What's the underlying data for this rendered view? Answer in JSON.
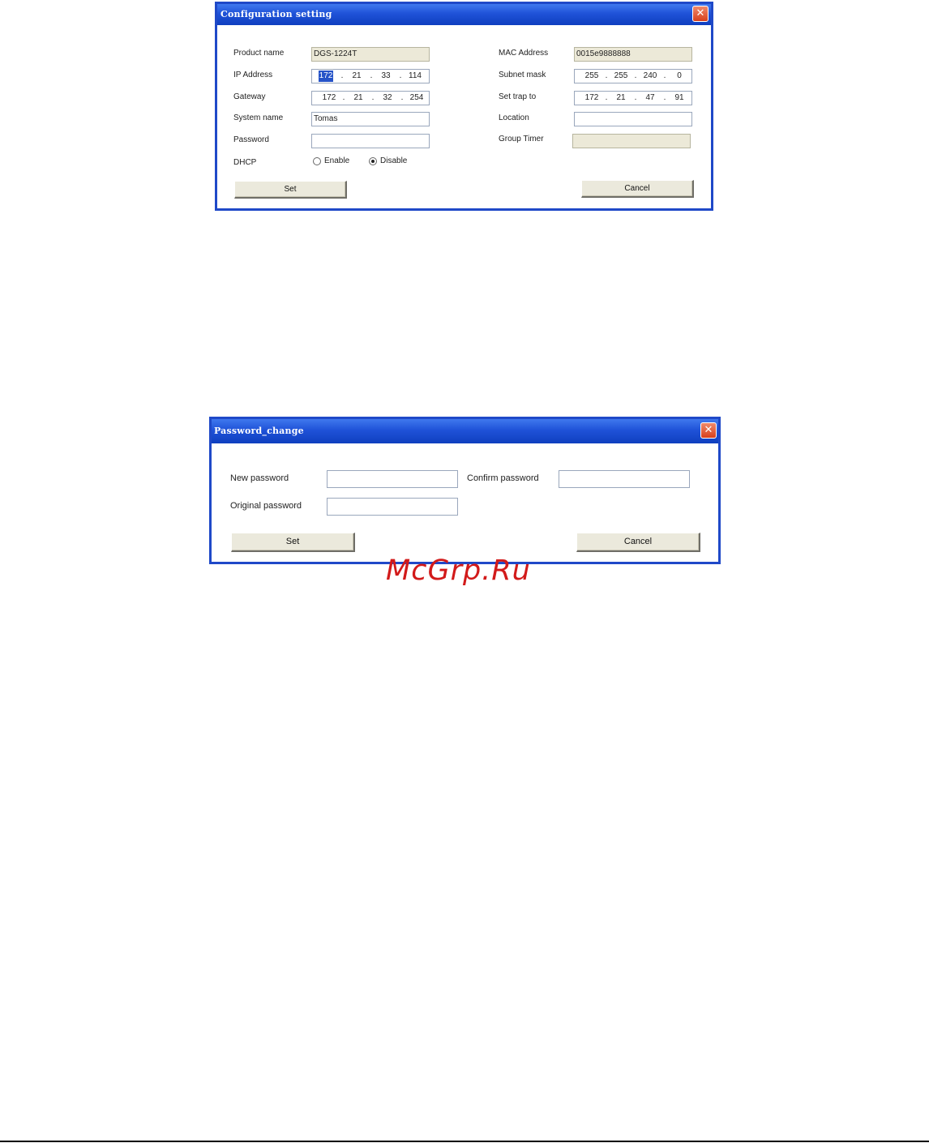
{
  "config_dialog": {
    "title": "Configuration setting",
    "close_glyph": "✕",
    "labels": {
      "product_name": "Product name",
      "ip_address": "IP Address",
      "gateway": "Gateway",
      "system_name": "System name",
      "password": "Password",
      "dhcp": "DHCP",
      "mac_address": "MAC Address",
      "subnet_mask": "Subnet mask",
      "set_trap_to": "Set trap to",
      "location": "Location",
      "group_timer": "Group Timer"
    },
    "values": {
      "product_name": "DGS-1224T",
      "mac_address": "0015e9888888",
      "system_name": "Tomas",
      "password": "",
      "location": "",
      "group_timer": ""
    },
    "ip_address": [
      "172",
      "21",
      "33",
      "114"
    ],
    "gateway": [
      "172",
      "21",
      "32",
      "254"
    ],
    "subnet_mask": [
      "255",
      "255",
      "240",
      "0"
    ],
    "set_trap_to": [
      "172",
      "21",
      "47",
      "91"
    ],
    "dhcp_options": {
      "enable": "Enable",
      "disable": "Disable",
      "selected": "Disable"
    },
    "buttons": {
      "set": "Set",
      "cancel": "Cancel"
    }
  },
  "password_dialog": {
    "title": "Password_change",
    "close_glyph": "✕",
    "labels": {
      "new_password": "New password",
      "confirm_password": "Confirm password",
      "original_password": "Original password"
    },
    "values": {
      "new_password": "",
      "confirm_password": "",
      "original_password": ""
    },
    "buttons": {
      "set": "Set",
      "cancel": "Cancel"
    }
  },
  "watermark": "McGrp.Ru",
  "colors": {
    "titlebar": "#1f52d8",
    "window_border": "#1f49c8",
    "close_button": "#d8401c",
    "readonly_field": "#ece9d8",
    "button_face": "#ebe9dc",
    "selection": "#2553c8",
    "watermark": "#d21a1a"
  }
}
